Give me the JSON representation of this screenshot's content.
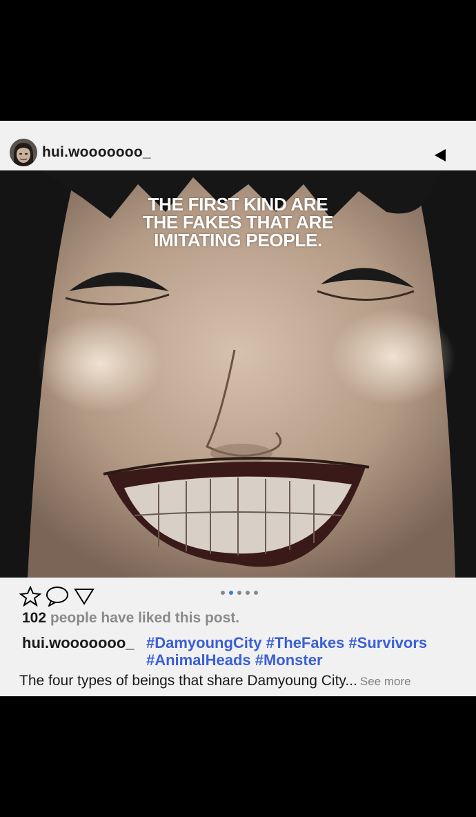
{
  "post": {
    "username": "hui.wooooooo_",
    "overlay_text": [
      "THE FIRST KIND ARE",
      "THE FAKES THAT ARE",
      "IMITATING PEOPLE."
    ],
    "icons": {
      "back": "triangle-left-icon",
      "like": "star-icon",
      "comment": "speech-bubble-icon",
      "share": "triangle-down-icon"
    },
    "carousel": {
      "count": 5,
      "active_index": 1
    },
    "likes": {
      "count": "102",
      "text": "people have liked this post."
    },
    "caption": {
      "username": "hui.wooooooo_",
      "hashtags": "#DamyoungCity #TheFakes #Survivors #AnimalHeads #Monster"
    },
    "description": "The four types of beings that share Damyoung City...",
    "see_more": "See more"
  },
  "colors": {
    "background": "#000000",
    "card": "#f1f1f1",
    "hashtag": "#3a5fd9",
    "active_dot": "#3a7bd5"
  }
}
